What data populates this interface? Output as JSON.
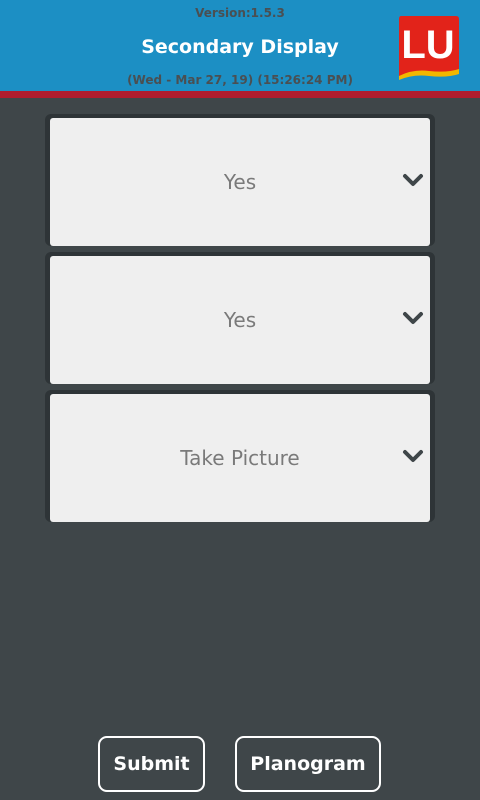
{
  "header": {
    "version": "Version:1.5.3",
    "title": "Secondary Display",
    "datetime": "(Wed - Mar 27, 19) (15:26:24 PM)",
    "logo_text": "LU",
    "logo_colors": {
      "background": "#e2231a",
      "text": "#ffffff",
      "accent": "#f2b700"
    }
  },
  "colors": {
    "header_bg": "#1c8fc4",
    "stripe": "#b01c2e",
    "page_bg": "#3f4649",
    "dropdown_bg": "#efefef",
    "dropdown_text": "#7a7a7a",
    "chevron": "#3f4649"
  },
  "dropdowns": [
    {
      "value": "Yes",
      "icon": "chevron-down-icon"
    },
    {
      "value": "Yes",
      "icon": "chevron-down-icon"
    },
    {
      "value": "Take Picture",
      "icon": "chevron-down-icon"
    }
  ],
  "buttons": {
    "submit": "Submit",
    "planogram": "Planogram"
  }
}
